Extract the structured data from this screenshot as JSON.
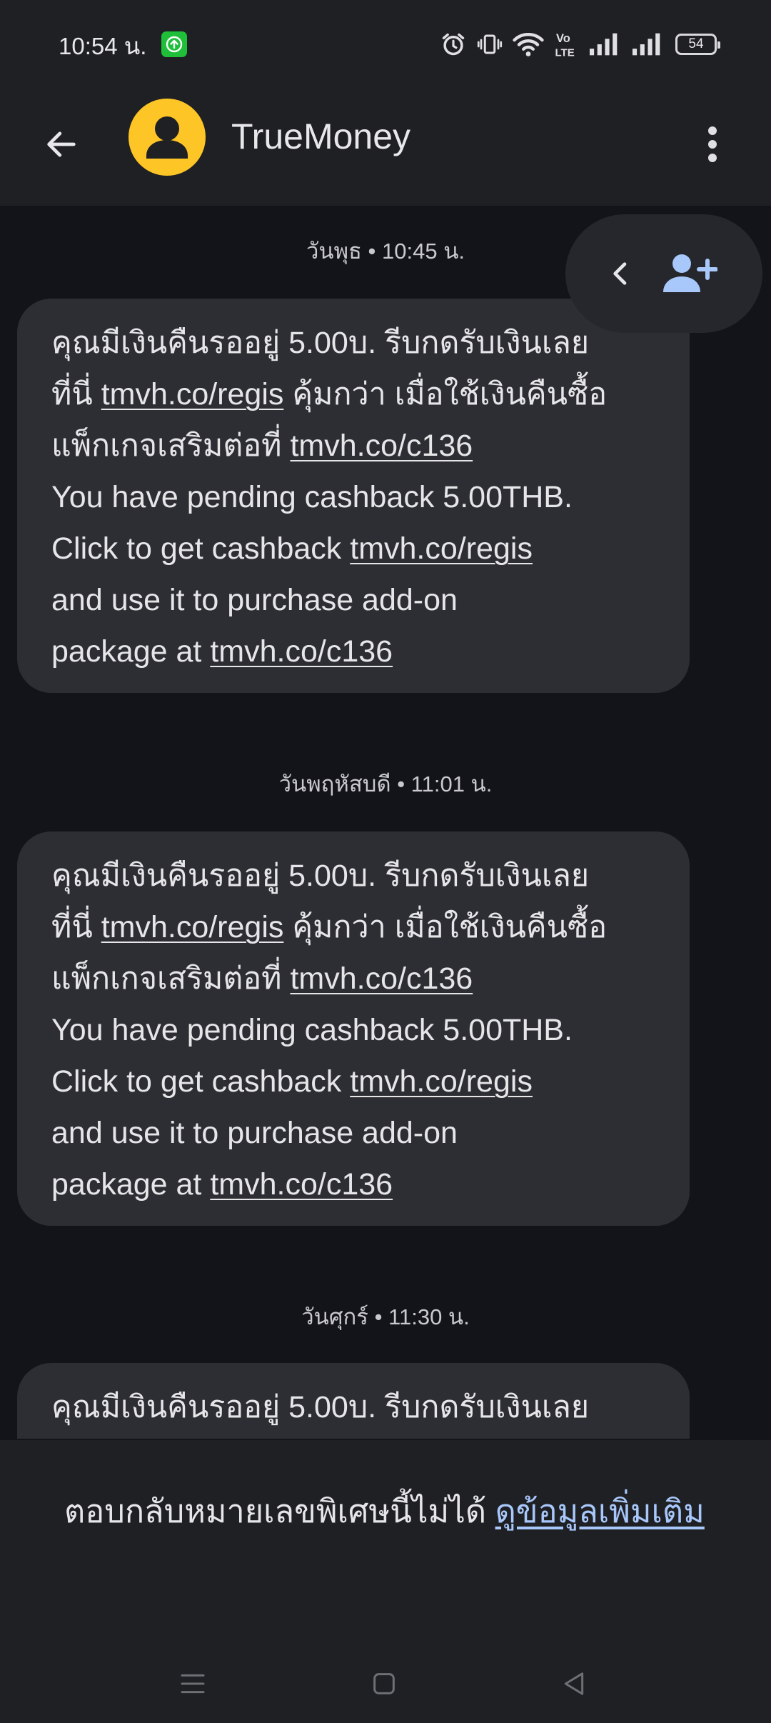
{
  "status_bar": {
    "time": "10:54 น.",
    "battery": "54",
    "icons": [
      "upload-notification-icon",
      "alarm-icon",
      "vibrate-icon",
      "wifi-icon",
      "volte-icon",
      "signal-icon",
      "signal-icon",
      "battery-icon"
    ]
  },
  "header": {
    "contact_name": "TrueMoney",
    "icons": [
      "back-arrow-icon",
      "avatar-person-icon",
      "more-vert-icon"
    ]
  },
  "floating_actions": {
    "icons": [
      "chevron-left-icon",
      "add-contact-icon"
    ]
  },
  "messages": [
    {
      "timestamp": "วันพุธ • 10:45 น.",
      "lines": [
        [
          "คุณมีเงินคืนรออยู่ 5.00บ. รีบกดรับเงินเลย"
        ],
        [
          "ที่นี่ ",
          "tmvh.co/regis",
          " คุ้มกว่า เมื่อใช้เงินคืนซื้อ"
        ],
        [
          "แพ็กเกจเสริมต่อที่ ",
          "tmvh.co/c136"
        ],
        [
          "You have pending cashback 5.00THB."
        ],
        [
          "Click to get cashback ",
          "tmvh.co/regis"
        ],
        [
          "and use it to purchase add-on"
        ],
        [
          "package at ",
          "tmvh.co/c136"
        ]
      ]
    },
    {
      "timestamp": "วันพฤหัสบดี • 11:01 น.",
      "lines": [
        [
          "คุณมีเงินคืนรออยู่ 5.00บ. รีบกดรับเงินเลย"
        ],
        [
          "ที่นี่ ",
          "tmvh.co/regis",
          " คุ้มกว่า เมื่อใช้เงินคืนซื้อ"
        ],
        [
          "แพ็กเกจเสริมต่อที่ ",
          "tmvh.co/c136"
        ],
        [
          "You have pending cashback 5.00THB."
        ],
        [
          "Click to get cashback ",
          "tmvh.co/regis"
        ],
        [
          "and use it to purchase add-on"
        ],
        [
          "package at ",
          "tmvh.co/c136"
        ]
      ]
    },
    {
      "timestamp": "วันศุกร์ • 11:30 น.",
      "lines": [
        [
          "คุณมีเงินคืนรออยู่ 5.00บ. รีบกดรับเงินเลย"
        ]
      ]
    }
  ],
  "notice": {
    "text": "ตอบกลับหมายเลขพิเศษนี้ไม่ได้ ",
    "link": "ดูข้อมูลเพิ่มเติม",
    "link_color": "#a8c7fa"
  },
  "nav": {
    "icons": [
      "recents-icon",
      "home-icon",
      "back-triangle-icon"
    ]
  },
  "colors": {
    "background": "#131419",
    "header": "#1f2024",
    "bubble": "#2d2e33",
    "avatar": "#fdc526"
  }
}
